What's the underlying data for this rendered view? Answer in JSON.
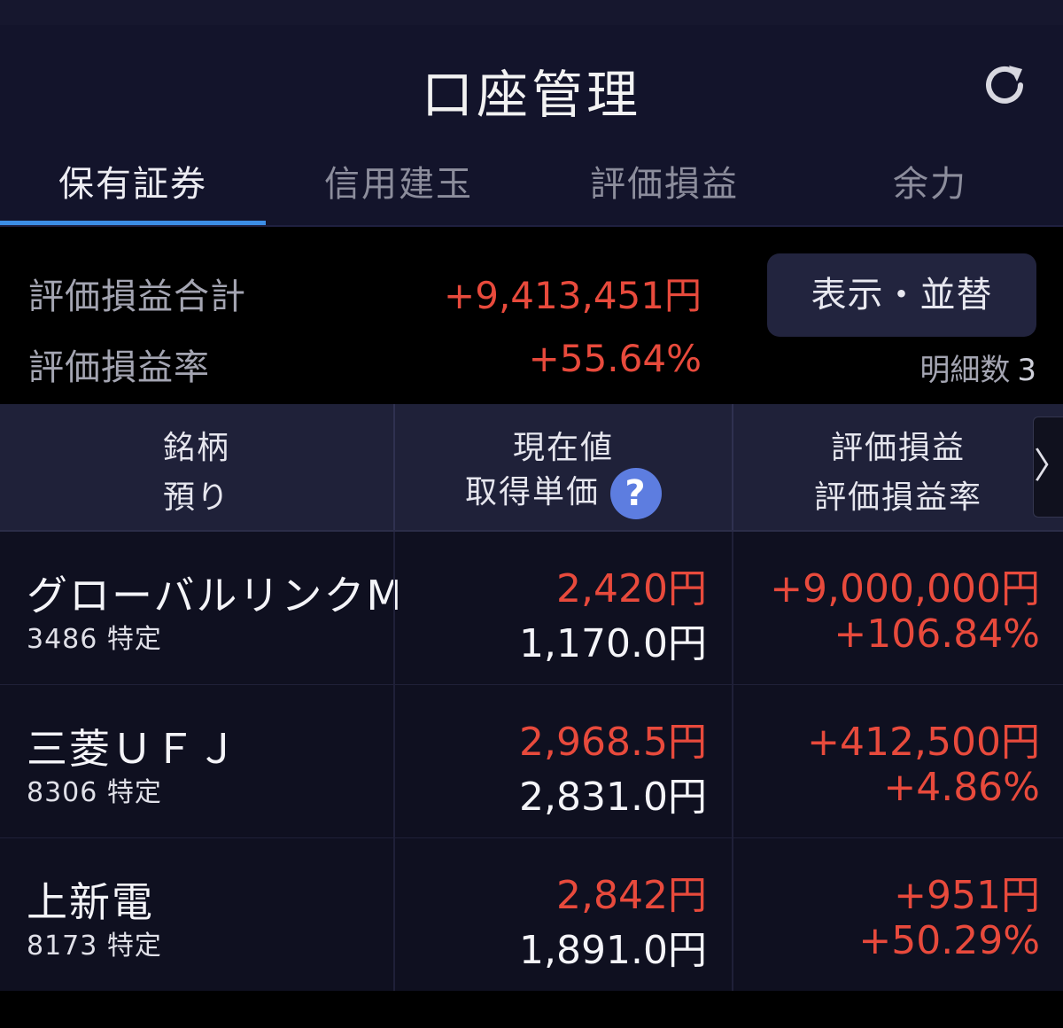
{
  "header": {
    "title": "口座管理",
    "refresh_icon": "refresh-icon"
  },
  "tabs": [
    {
      "label": "保有証券",
      "active": true
    },
    {
      "label": "信用建玉",
      "active": false
    },
    {
      "label": "評価損益",
      "active": false
    },
    {
      "label": "余力",
      "active": false
    }
  ],
  "summary": {
    "total_label": "評価損益合計",
    "total_value": "+9,413,451円",
    "rate_label": "評価損益率",
    "rate_value": "+55.64%",
    "sort_button": "表示・並替",
    "count_label": "明細数",
    "count_value": "3"
  },
  "table": {
    "headers": {
      "col1_line1": "銘柄",
      "col1_line2": "預り",
      "col2_line1": "現在値",
      "col2_line2": "取得単価",
      "col3_line1": "評価損益",
      "col3_line2": "評価損益率",
      "help_icon": "?",
      "scroll_icon": "〉"
    },
    "rows": [
      {
        "name": "グローバルリンクM",
        "code": "3486 特定",
        "current": "2,420円",
        "cost": "1,170.0円",
        "pl": "+9,000,000円",
        "pl_rate": "+106.84%"
      },
      {
        "name": "三菱ＵＦＪ",
        "code": "8306 特定",
        "current": "2,968.5円",
        "cost": "2,831.0円",
        "pl": "+412,500円",
        "pl_rate": "+4.86%"
      },
      {
        "name": "上新電",
        "code": "8173 特定",
        "current": "2,842円",
        "cost": "1,891.0円",
        "pl": "+951円",
        "pl_rate": "+50.29%"
      }
    ]
  },
  "colors": {
    "accent": "#3c8ee6",
    "gain": "#e84a3c",
    "help": "#5d7de0"
  }
}
